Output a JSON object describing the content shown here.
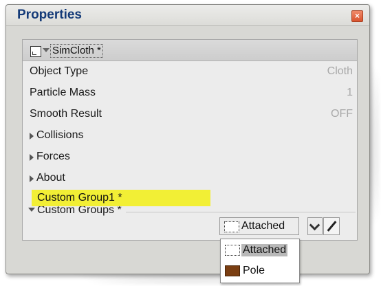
{
  "window": {
    "title": "Properties",
    "close_glyph": "×"
  },
  "node": {
    "name": "SimCloth *",
    "icon": "node-icon"
  },
  "properties": [
    {
      "label": "Object Type",
      "value": "Cloth"
    },
    {
      "label": "Particle Mass",
      "value": "1"
    },
    {
      "label": "Smooth Result",
      "value": "OFF"
    }
  ],
  "sections": [
    {
      "label": "Collisions"
    },
    {
      "label": "Forces"
    },
    {
      "label": "About"
    }
  ],
  "custom_groups": {
    "header": "Custom Groups *",
    "item_label": "Custom Group1 *",
    "item_highlight_color": "#f2ef35",
    "selected_value": "Attached"
  },
  "dropdown": {
    "options": [
      {
        "label": "Attached",
        "swatch": "none",
        "selected": true
      },
      {
        "label": "Pole",
        "swatch": "#7a3e12",
        "selected": false
      }
    ]
  }
}
